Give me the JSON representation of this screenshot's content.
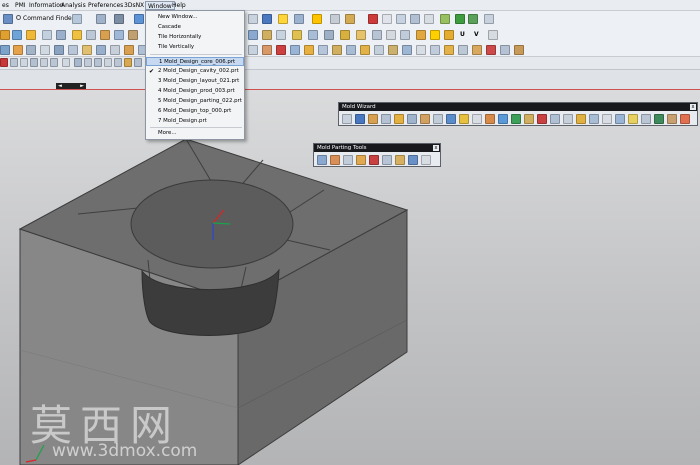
{
  "menubar": {
    "items": [
      "es",
      "PMI",
      "Information",
      "Analysis",
      "Preferences",
      "3DsNX",
      "Window",
      "Help"
    ],
    "active": "Window"
  },
  "toolbar": {
    "command_finder_label": "Command Finder"
  },
  "window_menu": {
    "items": [
      {
        "label": "New Window...",
        "checked": false,
        "selected": false
      },
      {
        "label": "Cascade",
        "checked": false,
        "selected": false
      },
      {
        "label": "Tile Horizontally",
        "checked": false,
        "selected": false
      },
      {
        "label": "Tile Vertically",
        "checked": false,
        "selected": false
      },
      {
        "label": "1 Mold_Design_core_006.prt",
        "checked": false,
        "selected": true
      },
      {
        "label": "2 Mold_Design_cavity_002.prt",
        "checked": true,
        "selected": false
      },
      {
        "label": "3 Mold_Design_layout_021.prt",
        "checked": false,
        "selected": false
      },
      {
        "label": "4 Mold_Design_prod_003.prt",
        "checked": false,
        "selected": false
      },
      {
        "label": "5 Mold_Design_parting_022.prt",
        "checked": false,
        "selected": false
      },
      {
        "label": "6 Mold_Design_top_000.prt",
        "checked": false,
        "selected": false
      },
      {
        "label": "7 Mold_Design.prt",
        "checked": false,
        "selected": false
      },
      {
        "label": "More...",
        "checked": false,
        "selected": false
      }
    ]
  },
  "mold_wizard": {
    "title": "Mold Wizard",
    "close_label": "x"
  },
  "mold_parting_tools": {
    "title": "Mold Parting Tools",
    "close_label": "x"
  },
  "navigator": {
    "left_arrow": "◄",
    "right_arrow": "►"
  },
  "watermark": {
    "chinese": "莫西网",
    "url": "www.3dmox.com"
  },
  "colors": {
    "model_top": "#6f6f6f",
    "model_front": "#858585",
    "model_side": "#6a6a6a",
    "title_bar": "#17191d",
    "selection": "#c6d9f1"
  }
}
